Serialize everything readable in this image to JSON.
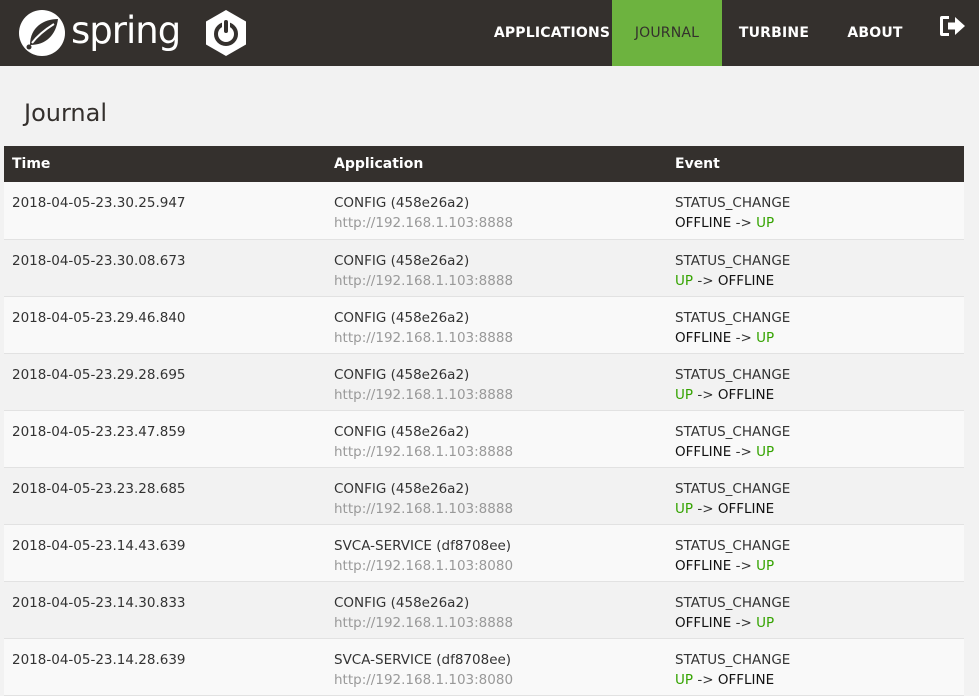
{
  "header": {
    "brand": "spring",
    "nav": [
      {
        "label": "APPLICATIONS",
        "active": false
      },
      {
        "label": "JOURNAL",
        "active": true
      },
      {
        "label": "TURBINE",
        "active": false
      },
      {
        "label": "ABOUT",
        "active": false
      }
    ],
    "logout_icon": "logout-icon",
    "accent_color": "#6db33f",
    "bar_color": "#34302d"
  },
  "page": {
    "title": "Journal"
  },
  "table": {
    "columns": [
      "Time",
      "Application",
      "Event"
    ],
    "arrow": "->",
    "colors": {
      "up": "#34a300",
      "offline": "#111111"
    },
    "rows": [
      {
        "time": "2018-04-05-23.30.25.947",
        "app": "CONFIG (458e26a2)",
        "url": "http://192.168.1.103:8888",
        "event": "STATUS_CHANGE",
        "from": "OFFLINE",
        "to": "UP"
      },
      {
        "time": "2018-04-05-23.30.08.673",
        "app": "CONFIG (458e26a2)",
        "url": "http://192.168.1.103:8888",
        "event": "STATUS_CHANGE",
        "from": "UP",
        "to": "OFFLINE"
      },
      {
        "time": "2018-04-05-23.29.46.840",
        "app": "CONFIG (458e26a2)",
        "url": "http://192.168.1.103:8888",
        "event": "STATUS_CHANGE",
        "from": "OFFLINE",
        "to": "UP"
      },
      {
        "time": "2018-04-05-23.29.28.695",
        "app": "CONFIG (458e26a2)",
        "url": "http://192.168.1.103:8888",
        "event": "STATUS_CHANGE",
        "from": "UP",
        "to": "OFFLINE"
      },
      {
        "time": "2018-04-05-23.23.47.859",
        "app": "CONFIG (458e26a2)",
        "url": "http://192.168.1.103:8888",
        "event": "STATUS_CHANGE",
        "from": "OFFLINE",
        "to": "UP"
      },
      {
        "time": "2018-04-05-23.23.28.685",
        "app": "CONFIG (458e26a2)",
        "url": "http://192.168.1.103:8888",
        "event": "STATUS_CHANGE",
        "from": "UP",
        "to": "OFFLINE"
      },
      {
        "time": "2018-04-05-23.14.43.639",
        "app": "SVCA-SERVICE (df8708ee)",
        "url": "http://192.168.1.103:8080",
        "event": "STATUS_CHANGE",
        "from": "OFFLINE",
        "to": "UP"
      },
      {
        "time": "2018-04-05-23.14.30.833",
        "app": "CONFIG (458e26a2)",
        "url": "http://192.168.1.103:8888",
        "event": "STATUS_CHANGE",
        "from": "OFFLINE",
        "to": "UP"
      },
      {
        "time": "2018-04-05-23.14.28.639",
        "app": "SVCA-SERVICE (df8708ee)",
        "url": "http://192.168.1.103:8080",
        "event": "STATUS_CHANGE",
        "from": "UP",
        "to": "OFFLINE"
      }
    ]
  }
}
